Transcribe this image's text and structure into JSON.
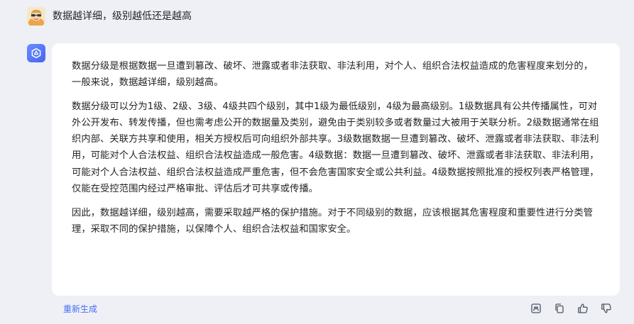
{
  "user_message": {
    "text": "数据越详细，级别越低还是越高"
  },
  "answer": {
    "paragraphs": [
      "数据分级是根据数据一旦遭到篡改、破坏、泄露或者非法获取、非法利用，对个人、组织合法权益造成的危害程度来划分的，一般来说，数据越详细，级别越高。",
      "数据分级可以分为1级、2级、3级、4级共四个级别，其中1级为最低级别，4级为最高级别。1级数据具有公共传播属性，可对外公开发布、转发传播，但也需考虑公开的数据量及类别，避免由于类别较多或者数量过大被用于关联分析。2级数据通常在组织内部、关联方共享和使用，相关方授权后可向组织外部共享。3级数据数据一旦遭到篡改、破坏、泄露或者非法获取、非法利用，可能对个人合法权益、组织合法权益造成一般危害。4级数据：数据一旦遭到篡改、破坏、泄露或者非法获取、非法利用，可能对个人合法权益、组织合法权益造成严重危害，但不会危害国家安全或公共利益。4级数据按照批准的授权列表严格管理，仅能在受控范围内经过严格审批、评估后才可共享或传播。",
      "因此，数据越详细，级别越高，需要采取越严格的保护措施。对于不同级别的数据，应该根据其危害程度和重要性进行分类管理，采取不同的保护措施，以保障个人、组织合法权益和国家安全。"
    ]
  },
  "footer": {
    "regenerate_label": "重新生成",
    "icons": [
      "export-icon",
      "copy-icon",
      "thumbs-up-icon",
      "thumbs-down-icon"
    ]
  },
  "colors": {
    "page_background": "#eef0f5",
    "card_background": "#ffffff",
    "text": "#262626",
    "link": "#4a6cf7",
    "bot_avatar": "#5570f5",
    "icon": "#4e5464"
  }
}
